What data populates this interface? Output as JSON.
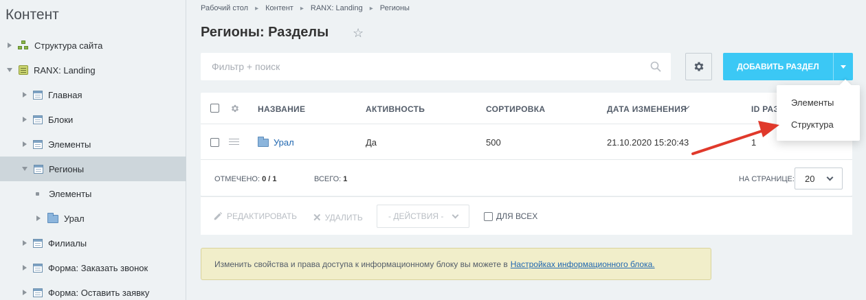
{
  "sidebar": {
    "title": "Контент",
    "items": [
      {
        "label": "Структура сайта"
      },
      {
        "label": "RANX: Landing"
      },
      {
        "label": "Главная"
      },
      {
        "label": "Блоки"
      },
      {
        "label": "Элементы"
      },
      {
        "label": "Регионы"
      },
      {
        "label": "Элементы"
      },
      {
        "label": "Урал"
      },
      {
        "label": "Филиалы"
      },
      {
        "label": "Форма: Заказать звонок"
      },
      {
        "label": "Форма: Оставить заявку"
      }
    ]
  },
  "breadcrumb": [
    "Рабочий стол",
    "Контент",
    "RANX: Landing",
    "Регионы"
  ],
  "page": {
    "title": "Регионы: Разделы"
  },
  "filter": {
    "placeholder": "Фильтр + поиск"
  },
  "toolbar": {
    "add_label": "ДОБАВИТЬ РАЗДЕЛ"
  },
  "grid": {
    "columns": [
      "НАЗВАНИЕ",
      "АКТИВНОСТЬ",
      "СОРТИРОВКА",
      "ДАТА ИЗМЕНЕНИЯ",
      "ID РАЗД"
    ],
    "rows": [
      {
        "name": "Урал",
        "active": "Да",
        "sort": "500",
        "date": "21.10.2020 15:20:43",
        "id": "1"
      }
    ],
    "footer": {
      "selected_label": "ОТМЕЧЕНО:",
      "selected_value": "0 / 1",
      "total_label": "ВСЕГО:",
      "total_value": "1",
      "per_page_label": "НА СТРАНИЦЕ:",
      "per_page_value": "20"
    }
  },
  "actions": {
    "edit": "РЕДАКТИРОВАТЬ",
    "delete": "УДАЛИТЬ",
    "select": "- ДЕЙСТВИЯ -",
    "for_all": "ДЛЯ ВСЕХ"
  },
  "notice": {
    "text": "Изменить свойства и права доступа к информационному блоку вы можете в",
    "link": "Настройках информационного блока."
  },
  "dropdown": {
    "items": [
      "Элементы",
      "Структура"
    ]
  },
  "colors": {
    "accent": "#3bc8f5",
    "arrow": "#e0392b",
    "notice_bg": "#f1eeca"
  }
}
